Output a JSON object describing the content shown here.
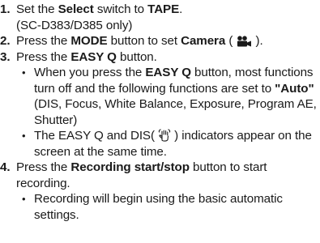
{
  "steps": [
    {
      "num": "1.",
      "t1": "Set the ",
      "b1": "Select",
      "t2": " switch to ",
      "b2": "TAPE",
      "t3": ".",
      "note": "(SC-D383/D385 only)"
    },
    {
      "num": "2.",
      "t1": "Press the ",
      "b1": "MODE",
      "t2": " button to set ",
      "b2": "Camera",
      "t3": " ( ",
      "icon": "camera-mode-icon",
      "t4": " )."
    },
    {
      "num": "3.",
      "t1": "Press the ",
      "b1": "EASY Q",
      "t2": " button.",
      "bullets": [
        {
          "t1": "When you press the ",
          "b1": "EASY Q",
          "t2": " button, most functions turn off and the following functions are set to ",
          "b2": "\"Auto\"",
          "t3": " (DIS, Focus, White Balance, Exposure, Program AE, Shutter)"
        },
        {
          "t1": "The EASY Q and DIS( ",
          "icon": "dis-hand-icon",
          "t2": " ) indicators appear on the screen at the same time."
        }
      ]
    },
    {
      "num": "4.",
      "t1": "Press the ",
      "b1": "Recording start/stop",
      "t2": " button to start recording.",
      "bullets": [
        {
          "t1": "Recording will begin using the basic automatic settings."
        }
      ]
    }
  ],
  "bullet_glyph": "•"
}
